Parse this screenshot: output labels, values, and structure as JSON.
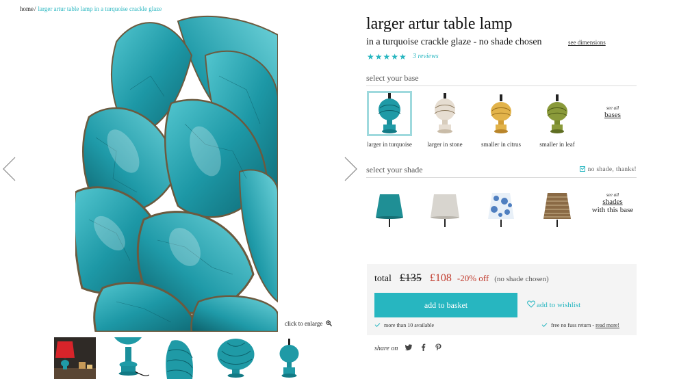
{
  "breadcrumb": {
    "home": "home",
    "separator": "/",
    "current": "larger artur table lamp in a turquoise crackle glaze"
  },
  "gallery": {
    "prev_icon": "chevron-left-icon",
    "next_icon": "chevron-right-icon",
    "enlarge_label": "click to enlarge",
    "enlarge_icon": "zoom-icon",
    "thumbnail_count": 5
  },
  "product": {
    "title": "larger artur table lamp",
    "subtitle": "in a turquoise crackle glaze - no shade chosen",
    "dimensions_link": "see dimensions",
    "stars": "★★★★★",
    "rating": 5,
    "reviews_link": "3 reviews"
  },
  "base": {
    "heading": "select your base",
    "options": [
      {
        "label": "larger in turquoise",
        "color": "#1f9aa6",
        "selected": true
      },
      {
        "label": "larger in stone",
        "color": "#e6ddd1",
        "selected": false
      },
      {
        "label": "smaller in citrus",
        "color": "#e2b34a",
        "selected": false
      },
      {
        "label": "smaller in leaf",
        "color": "#8a9a3a",
        "selected": false
      }
    ],
    "see_all_small": "see all",
    "see_all_link": "bases"
  },
  "shade": {
    "heading": "select your shade",
    "no_shade_label": "no shade, thanks!",
    "options": [
      {
        "name": "turquoise-shade",
        "color": "#1f8f95"
      },
      {
        "name": "stone-shade",
        "color": "#d8d5cf"
      },
      {
        "name": "blue-floral-shade",
        "color": "#7fa8d4"
      },
      {
        "name": "brown-pattern-shade",
        "color": "#8a6a45"
      }
    ],
    "see_all_small": "see all",
    "see_all_link": "shades",
    "see_all_extra": "with this base"
  },
  "basket": {
    "total_label": "total",
    "old_price": "£135",
    "new_price": "£108",
    "discount": "-20% off",
    "note": "(no shade chosen)",
    "add_button": "add to basket",
    "wishlist": "add to wishlist",
    "stock": "more than 10 available",
    "returns": "free no fuss return -",
    "returns_link": "read more!"
  },
  "share": {
    "label": "share on",
    "networks": [
      "twitter-icon",
      "facebook-icon",
      "pinterest-icon"
    ]
  },
  "colors": {
    "accent": "#27b6c0",
    "sale": "#c0392b",
    "box_bg": "#f4f4f4"
  }
}
